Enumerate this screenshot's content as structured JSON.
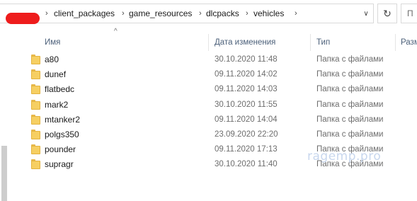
{
  "address_bar": {
    "crumbs": [
      "client_packages",
      "game_resources",
      "dlcpacks",
      "vehicles"
    ],
    "separator": "›",
    "dropdown_glyph": "∨",
    "refresh_glyph": "↻",
    "search_placeholder": "П"
  },
  "columns": {
    "name": "Имя",
    "date": "Дата изменения",
    "type": "Тип",
    "size": "Разм"
  },
  "sort_indicator": "^",
  "rows": [
    {
      "name": "a80",
      "date": "30.10.2020 11:48",
      "type": "Папка с файлами"
    },
    {
      "name": "dunef",
      "date": "09.11.2020 14:02",
      "type": "Папка с файлами"
    },
    {
      "name": "flatbedc",
      "date": "09.11.2020 14:03",
      "type": "Папка с файлами"
    },
    {
      "name": "mark2",
      "date": "30.10.2020 11:55",
      "type": "Папка с файлами"
    },
    {
      "name": "mtanker2",
      "date": "09.11.2020 14:04",
      "type": "Папка с файлами"
    },
    {
      "name": "polgs350",
      "date": "23.09.2020 22:20",
      "type": "Папка с файлами"
    },
    {
      "name": "pounder",
      "date": "09.11.2020 17:13",
      "type": "Папка с файлами"
    },
    {
      "name": "supragr",
      "date": "30.10.2020 11:40",
      "type": "Папка с файлами"
    }
  ],
  "watermark": "ragemp.pro",
  "colors": {
    "redaction": "#ee1c1c",
    "folder": "#f6cf62",
    "header_text": "#4c607a"
  }
}
